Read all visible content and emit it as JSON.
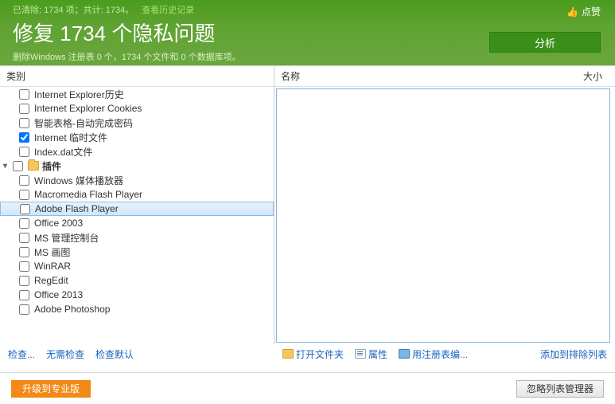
{
  "header": {
    "status_prefix": "已清除: 1734 项；共计: 1734。",
    "history_link": "查看历史记录",
    "title_prefix": "修复",
    "title_count": "1734",
    "title_suffix": "个隐私问题",
    "subtitle": "删除Windows 注册表 0 个，1734 个文件和 0 个数据库项。",
    "like_label": "点赞",
    "analyze_button": "分析"
  },
  "columns": {
    "category": "类别",
    "name": "名称",
    "size": "大小"
  },
  "tree": {
    "group_plugins": "插件",
    "items": [
      {
        "label": "Internet Explorer历史",
        "checked": false
      },
      {
        "label": "Internet Explorer Cookies",
        "checked": false
      },
      {
        "label": "智能表格-自动完成密码",
        "checked": false
      },
      {
        "label": "Internet 临时文件",
        "checked": true
      },
      {
        "label": "Index.dat文件",
        "checked": false
      }
    ],
    "plugin_items": [
      {
        "label": "Windows 媒体播放器",
        "checked": false
      },
      {
        "label": "Macromedia Flash Player",
        "checked": false
      },
      {
        "label": "Adobe Flash Player",
        "checked": false,
        "selected": true
      },
      {
        "label": "Office 2003",
        "checked": false
      },
      {
        "label": "MS 管理控制台",
        "checked": false
      },
      {
        "label": "MS 画图",
        "checked": false
      },
      {
        "label": "WinRAR",
        "checked": false
      },
      {
        "label": "RegEdit",
        "checked": false
      },
      {
        "label": "Office 2013",
        "checked": false
      },
      {
        "label": "Adobe Photoshop",
        "checked": false
      }
    ]
  },
  "left_links": {
    "check": "检查...",
    "no_check": "无需检查",
    "check_default": "检查默认"
  },
  "right_links": {
    "open_folder": "打开文件夹",
    "properties": "属性",
    "reg_edit": "用注册表编...",
    "add_exclude": "添加到排除列表"
  },
  "footer": {
    "upgrade": "升级到专业版",
    "ignore_manager": "忽略列表管理器"
  }
}
